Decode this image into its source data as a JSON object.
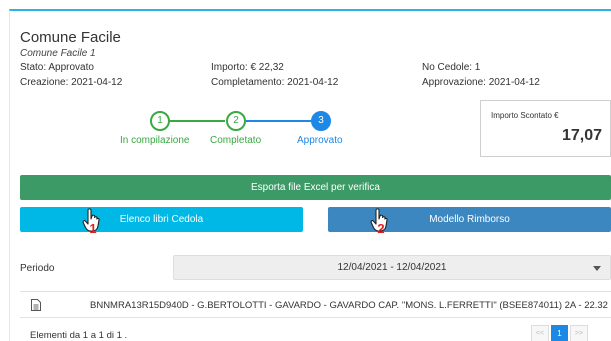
{
  "header": {
    "title": "Comune Facile",
    "subtitle": "Comune Facile 1"
  },
  "meta": {
    "stato": "Stato: Approvato",
    "importo": "Importo: € 22,32",
    "no_cedole": "No Cedole: 1",
    "creazione": "Creazione: 2021-04-12",
    "completamento": "Completamento: 2021-04-12",
    "approvazione": "Approvazione: 2021-04-12"
  },
  "stepper": {
    "steps": [
      {
        "number": "1",
        "label": "In compilazione",
        "state": "done"
      },
      {
        "number": "2",
        "label": "Completato",
        "state": "done"
      },
      {
        "number": "3",
        "label": "Approvato",
        "state": "active"
      }
    ],
    "colors": {
      "done": "#3aa843",
      "active": "#1e88e5"
    }
  },
  "price": {
    "label": "Importo Scontato €",
    "value": "17,07"
  },
  "buttons": {
    "export": "Esporta file Excel per verifica",
    "elenco": "Elenco libri Cedola",
    "modello": "Modello Rimborso"
  },
  "annotations": {
    "hand_1": "1",
    "hand_2": "2"
  },
  "periodo": {
    "label": "Periodo",
    "value": "12/04/2021 - 12/04/2021"
  },
  "rows": [
    {
      "icon": "document-icon",
      "text": "BNNMRA13R15D940D - G.BERTOLOTTI - GAVARDO - GAVARDO CAP. \"MONS. L.FERRETTI\" (BSEE874011) 2A - 22.32"
    }
  ],
  "footer": {
    "summary": "Elementi da 1 a 1 di 1 .",
    "pager": {
      "prev": "<<",
      "current": "1",
      "next": ">>"
    }
  }
}
